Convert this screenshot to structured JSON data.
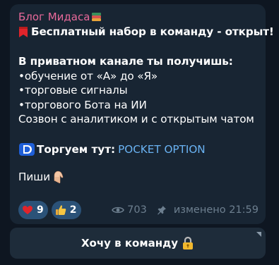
{
  "post": {
    "sender": "Блог Мидаса",
    "sender_icon": "books-icon",
    "headline": "Бесплатный набор в команду - открыт!",
    "headline_icon": "bookmark-icon",
    "intro": "В приватном канале ты получишь:",
    "bullets": [
      "•обучение от «А» до «Я»",
      "•торговые сигналы",
      "•торгового Бота на ИИ"
    ],
    "call_line": "Созвон с аналитиком и с открытым чатом",
    "trade_label": "Торгуем тут:",
    "trade_link": "POCKET OPTION",
    "write_label": "Пиши",
    "write_icon": "hand-pointing-down-icon"
  },
  "reactions": [
    {
      "icon": "heart-icon",
      "count": "9"
    },
    {
      "icon": "thumbs-up-icon",
      "count": "2"
    }
  ],
  "meta": {
    "views": "703",
    "edited": "изменено 21:59"
  },
  "inline_button": {
    "label": "Хочу в команду",
    "icon": "lock-key-icon"
  },
  "colors": {
    "background": "#0e1621",
    "bubble": "#182533",
    "sender": "#e8699a",
    "link": "#6ab3f3",
    "reaction_bg": "#2b5278",
    "meta": "#6d7f8f"
  }
}
